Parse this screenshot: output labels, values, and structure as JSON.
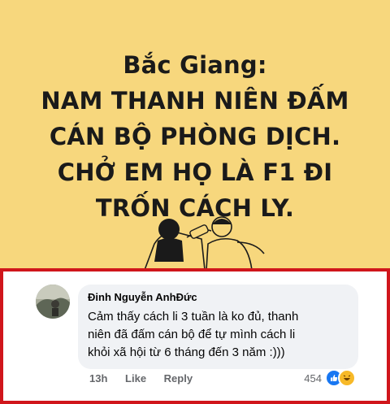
{
  "banner": {
    "lines": [
      "Bắc Giang:",
      "NAM THANH NIÊN ĐẤM",
      "CÁN BỘ PHÒNG DỊCH.",
      "CHỞ EM HỌ LÀ F1 ĐI",
      "TRỐN CÁCH LY."
    ],
    "background": "#f7d77d"
  },
  "comment": {
    "author": "Đinh Nguyễn AnhĐức",
    "text_lines": [
      "Cảm thấy cách li 3 tuần là ko đủ, thanh",
      "niên đã đấm cán bộ để tự mình cách li",
      "khỏi xã hội  từ 6 tháng đến 3 năm :)))"
    ],
    "time": "13h",
    "like_label": "Like",
    "reply_label": "Reply",
    "reaction_count": "454",
    "reaction_icons": [
      "like-icon",
      "haha-icon"
    ],
    "highlight_border": "#d0161b"
  }
}
